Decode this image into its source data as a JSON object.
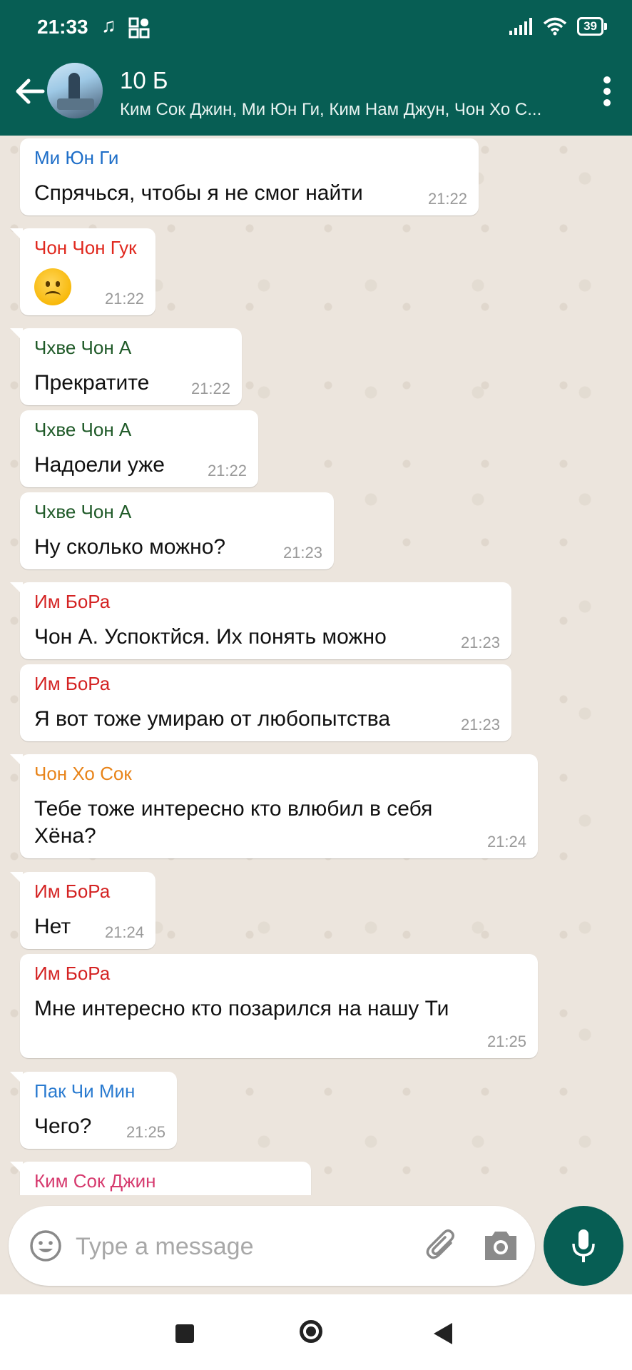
{
  "status_bar": {
    "time": "21:33",
    "battery": "39"
  },
  "header": {
    "title": "10 Б",
    "members": "Ким Сок Джин, Ми Юн Ги, Ким Нам Джун, Чон Хо С..."
  },
  "messages": [
    {
      "sender": "Ми Юн Ги",
      "sender_color": "#1e6ec8",
      "text": "Спрячься, чтобы я не смог найти",
      "time": "21:22"
    },
    {
      "sender": "Чон Чон Гук",
      "sender_color": "#e0281e",
      "emoji": "frowning-face-icon",
      "time": "21:22"
    },
    {
      "sender": "Чхве Чон А",
      "sender_color": "#1f5a28",
      "text": "Прекратите",
      "time": "21:22"
    },
    {
      "sender": "Чхве Чон А",
      "sender_color": "#1f5a28",
      "text": "Надоели уже",
      "time": "21:22"
    },
    {
      "sender": "Чхве Чон А",
      "sender_color": "#1f5a28",
      "text": "Ну сколько можно?",
      "time": "21:23"
    },
    {
      "sender": "Им БоРа",
      "sender_color": "#d42222",
      "text": "Чон А. Успоктйся. Их понять можно",
      "time": "21:23"
    },
    {
      "sender": "Им БоРа",
      "sender_color": "#d42222",
      "text": "Я вот тоже умираю от любопытства",
      "time": "21:23"
    },
    {
      "sender": "Чон Хо Сок",
      "sender_color": "#e8841a",
      "text": "Тебе тоже интересно кто влюбил в себя Хёна?",
      "time": "21:24"
    },
    {
      "sender": "Им БоРа",
      "sender_color": "#d42222",
      "text": "Нет",
      "time": "21:24"
    },
    {
      "sender": "Им БоРа",
      "sender_color": "#d42222",
      "text": "Мне интересно кто позарился на нашу Ти",
      "time": "21:25"
    },
    {
      "sender": "Пак Чи Мин",
      "sender_color": "#2a7bd0",
      "text": "Чего?",
      "time": "21:25"
    },
    {
      "sender": "Ким Сок Джин",
      "sender_color": "#d63a6e"
    }
  ],
  "composer": {
    "placeholder": "Type a message"
  },
  "colors": {
    "header_bg": "#075e54",
    "chat_bg": "#ece5dd",
    "bubble_bg": "#ffffff"
  }
}
